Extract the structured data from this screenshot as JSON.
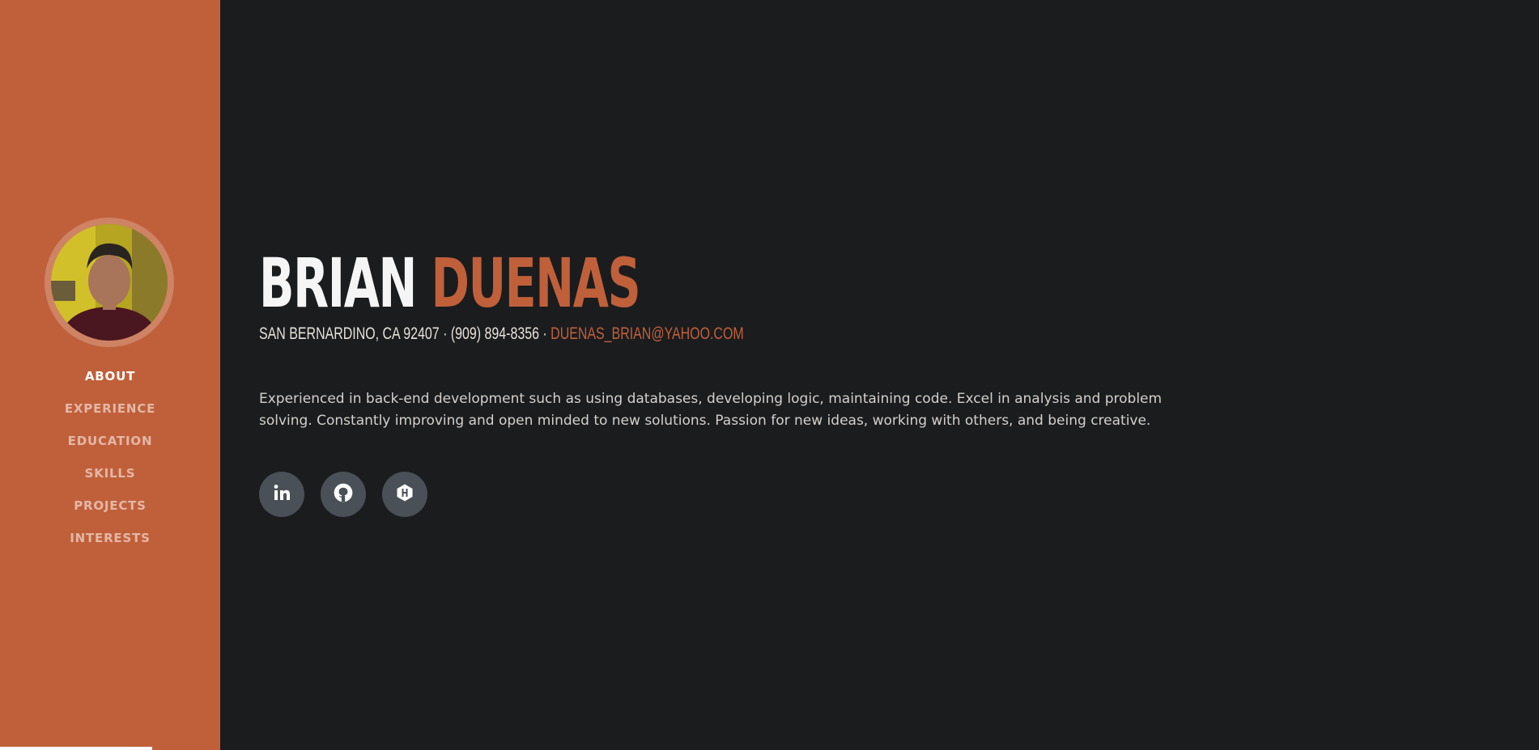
{
  "colors": {
    "accent": "#c0603a",
    "background": "#1b1c1e",
    "social_button": "#495057"
  },
  "sidebar": {
    "avatar": "profile-photo",
    "nav": [
      {
        "label": "ABOUT",
        "active": true
      },
      {
        "label": "EXPERIENCE",
        "active": false
      },
      {
        "label": "EDUCATION",
        "active": false
      },
      {
        "label": "SKILLS",
        "active": false
      },
      {
        "label": "PROJECTS",
        "active": false
      },
      {
        "label": "INTERESTS",
        "active": false
      }
    ]
  },
  "header": {
    "first_name": "BRIAN",
    "last_name": "DUENAS",
    "location": "SAN BERNARDINO, CA 92407",
    "phone": "(909) 894-8356",
    "separator": " · ",
    "email": "DUENAS_BRIAN@YAHOO.COM"
  },
  "about": {
    "text": "Experienced in back-end development such as using databases, developing logic, maintaining code. Excel in analysis and problem solving. Constantly improving and open minded to new solutions. Passion for new ideas, working with others, and being creative."
  },
  "socials": [
    {
      "icon": "linkedin-icon"
    },
    {
      "icon": "github-icon"
    },
    {
      "icon": "hackerrank-icon"
    }
  ]
}
